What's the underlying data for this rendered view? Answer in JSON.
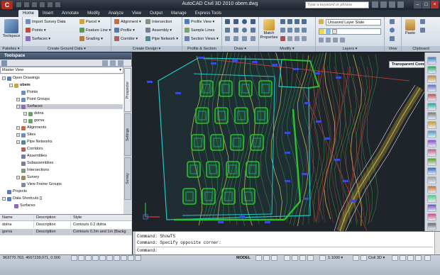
{
  "window": {
    "title": "AutoCAD Civil 3D 2010    obem.dwg",
    "search_placeholder": "Type a keyword or phrase",
    "logo": "C",
    "controls": [
      "–",
      "□",
      "×"
    ]
  },
  "ribbon": {
    "tabs": [
      "Home",
      "Insert",
      "Annotate",
      "Modify",
      "Analyze",
      "View",
      "Output",
      "Manage",
      "Express Tools"
    ],
    "active_tab": "Home",
    "panels": {
      "palettes": {
        "title": "Palettes ▾",
        "toolspace": "Toolspace"
      },
      "ground_data": {
        "title": "Create Ground Data ▾",
        "items": [
          "Import Survey Data",
          "Points ▾",
          "Surfaces ▾",
          "Parcel ▾",
          "Feature Line ▾",
          "Grading ▾"
        ]
      },
      "design": {
        "title": "Create Design ▾",
        "items": [
          "Alignment ▾",
          "Profile ▾",
          "Corridor ▾",
          "Intersection",
          "Assembly ▾",
          "Pipe Network ▾"
        ]
      },
      "profile_section": {
        "title": "Profile & Section Views",
        "items": [
          "Profile View ▾",
          "Sample Lines",
          "Section Views ▾"
        ]
      },
      "draw": {
        "title": "Draw ▾"
      },
      "modify": {
        "title": "Modify ▾",
        "match_properties": "Match Properties"
      },
      "layers": {
        "title": "Layers ▾",
        "layer_state": "Unsaved Layer State"
      },
      "view": {
        "title": "View"
      },
      "clipboard": {
        "title": "Clipboard",
        "paste": "Paste"
      }
    }
  },
  "toolspace": {
    "title": "Toolspace",
    "view_select": "Master View",
    "tree": [
      {
        "label": "Open Drawings",
        "level": 1,
        "expander": "−",
        "icon": "#5a7fb8"
      },
      {
        "label": "obem",
        "level": 2,
        "expander": "−",
        "icon": "#c9a640",
        "bold": true
      },
      {
        "label": "Points",
        "level": 3,
        "expander": "",
        "icon": "#6a8fbf"
      },
      {
        "label": "Point Groups",
        "level": 3,
        "expander": "+",
        "icon": "#6a8fbf"
      },
      {
        "label": "Surfaces",
        "level": 3,
        "expander": "−",
        "icon": "#8a6db5",
        "selected": true
      },
      {
        "label": "dolna",
        "level": 4,
        "expander": "+",
        "icon": "#6aa06a"
      },
      {
        "label": "gorna",
        "level": 4,
        "expander": "+",
        "icon": "#6aa06a"
      },
      {
        "label": "Alignments",
        "level": 3,
        "expander": "+",
        "icon": "#c86a3a"
      },
      {
        "label": "Sites",
        "level": 3,
        "expander": "+",
        "icon": "#6a8fbf"
      },
      {
        "label": "Pipe Networks",
        "level": 3,
        "expander": "+",
        "icon": "#4b8a9a"
      },
      {
        "label": "Corridors",
        "level": 3,
        "expander": "",
        "icon": "#b55d5d"
      },
      {
        "label": "Assemblies",
        "level": 3,
        "expander": "",
        "icon": "#7a7a9a"
      },
      {
        "label": "Subassemblies",
        "level": 3,
        "expander": "",
        "icon": "#7a7a9a"
      },
      {
        "label": "Intersections",
        "level": 3,
        "expander": "",
        "icon": "#7a9a7a"
      },
      {
        "label": "Survey",
        "level": 3,
        "expander": "+",
        "icon": "#a08a5a"
      },
      {
        "label": "View Frame Groups",
        "level": 3,
        "expander": "",
        "icon": "#7a8aaa"
      },
      {
        "label": "Projects",
        "level": 1,
        "expander": "",
        "icon": "#5a7fb8"
      },
      {
        "label": "Data Shortcuts []",
        "level": 1,
        "expander": "−",
        "icon": "#5a7fb8"
      },
      {
        "label": "Surfaces",
        "level": 2,
        "expander": "",
        "icon": "#8a6db5"
      }
    ],
    "side_tabs": [
      "Prospector",
      "Settings",
      "Survey"
    ],
    "grid": {
      "headers": [
        "Name",
        "Description",
        "Style"
      ],
      "rows": [
        [
          "dolna",
          "Description",
          "Contours 0.2 dolna"
        ],
        [
          "gorna",
          "Description",
          "Contours 0.2m and 1m (Backg"
        ]
      ],
      "selected_row": 1
    }
  },
  "canvas": {
    "transparent_commands": "Transparent Commands",
    "background": "#1e2429"
  },
  "command_line": {
    "lines": [
      "Command: ShowTS",
      "Command: Specify opposite corner:",
      "Command:"
    ]
  },
  "status": {
    "coordinates": "963770.763, 4667239.071, 0.000",
    "model": "MODEL",
    "scale": "1:1000 ▾",
    "workspace": "Civil 3D ▾"
  }
}
